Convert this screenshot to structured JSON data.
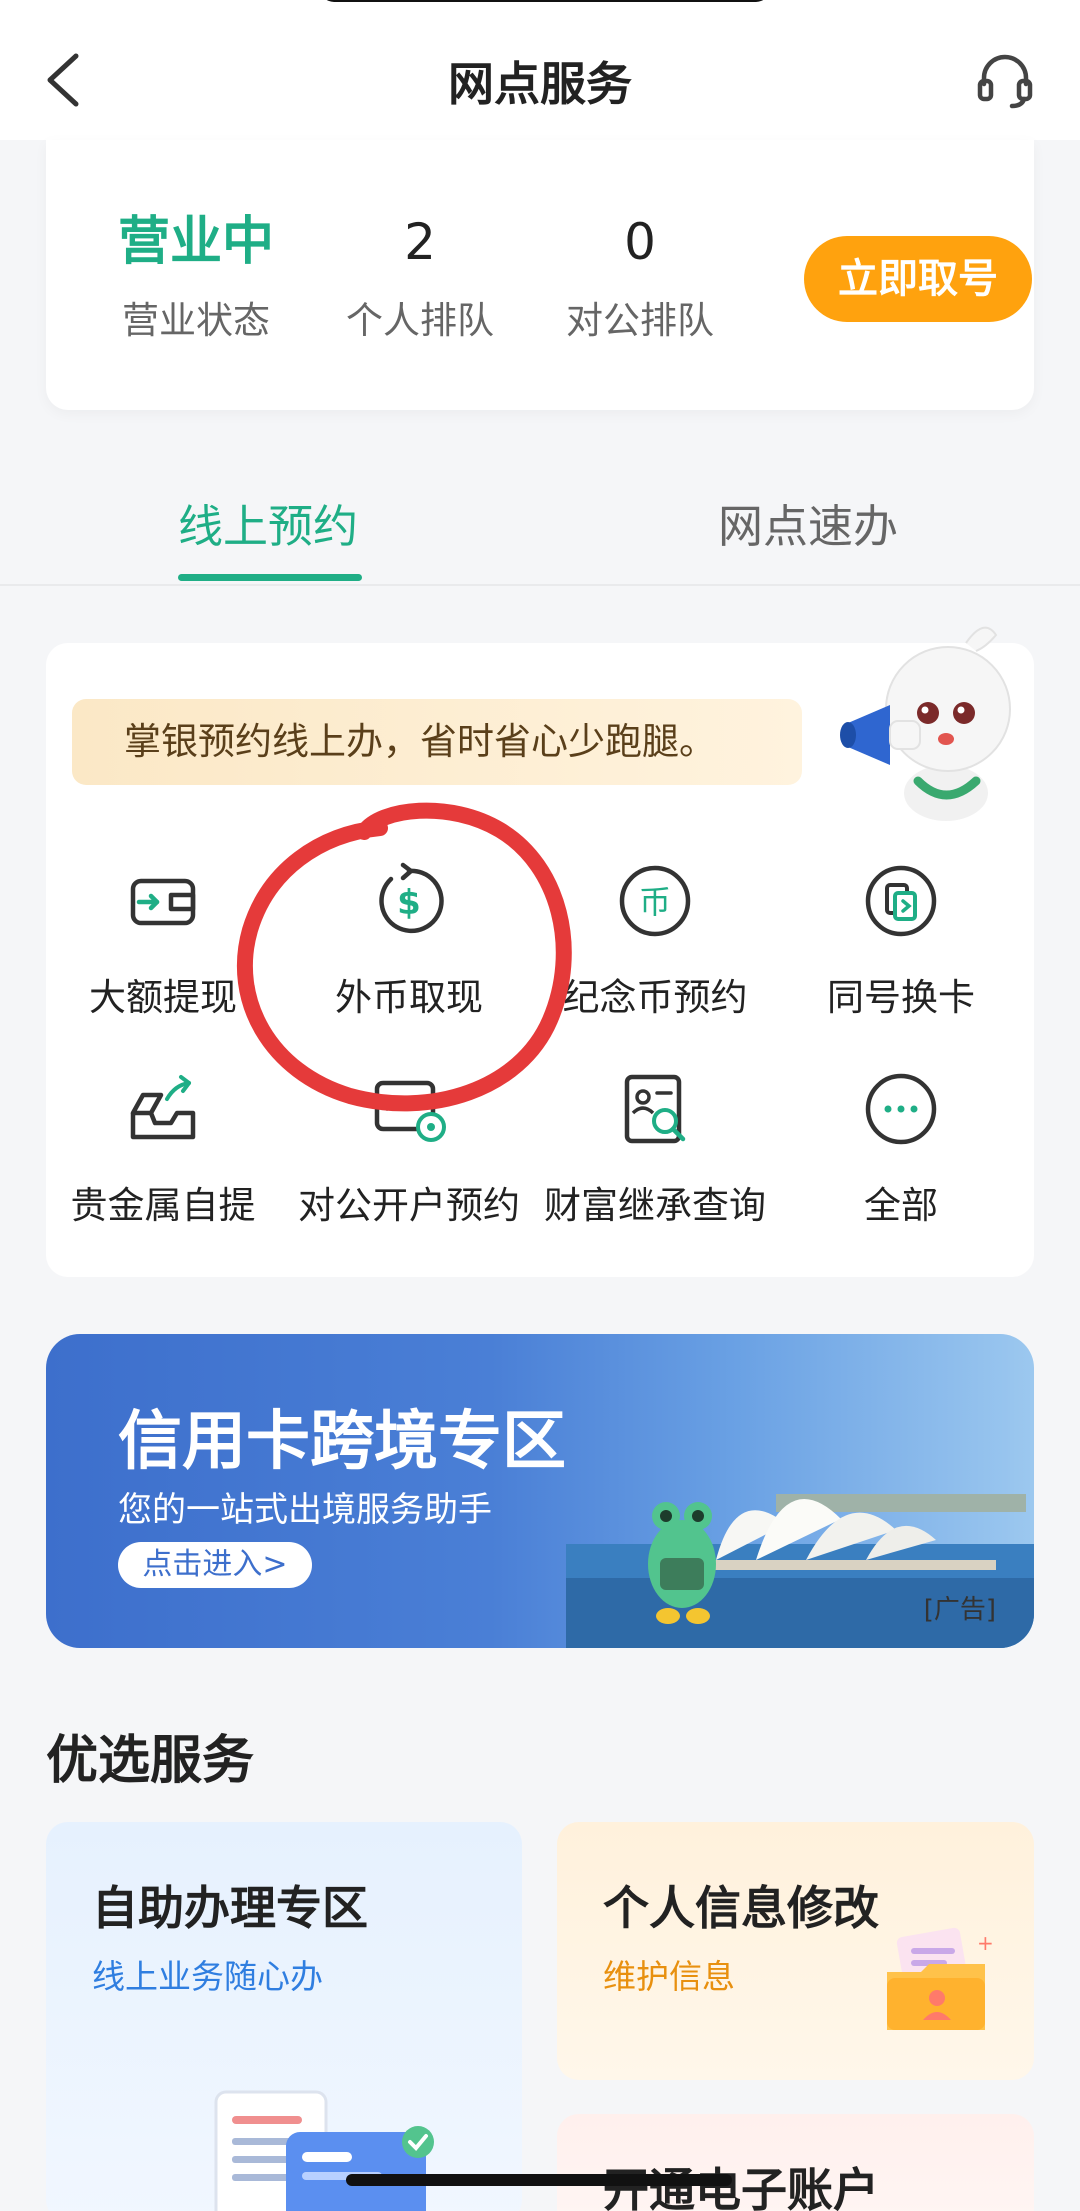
{
  "header": {
    "title": "网点服务"
  },
  "branch_status": {
    "business_status": {
      "value": "营业中",
      "label": "营业状态"
    },
    "personal_queue": {
      "value": "2",
      "label": "个人排队"
    },
    "corporate_queue": {
      "value": "0",
      "label": "对公排队"
    },
    "ticket_button": "立即取号"
  },
  "tabs": [
    {
      "label": "线上预约",
      "active": true
    },
    {
      "label": "网点速办",
      "active": false
    }
  ],
  "promo_text": "掌银预约线上办，省时省心少跑腿。",
  "services": [
    {
      "label": "大额提现",
      "icon": "wallet-transfer-icon"
    },
    {
      "label": "外币取现",
      "icon": "currency-refresh-icon"
    },
    {
      "label": "纪念币预约",
      "icon": "coin-icon"
    },
    {
      "label": "同号换卡",
      "icon": "card-swap-icon"
    },
    {
      "label": "贵金属自提",
      "icon": "gold-box-icon"
    },
    {
      "label": "对公开户预约",
      "icon": "corporate-account-icon"
    },
    {
      "label": "财富继承查询",
      "icon": "inheritance-search-icon"
    },
    {
      "label": "全部",
      "icon": "more-icon"
    }
  ],
  "banner": {
    "title": "信用卡跨境专区",
    "subtitle": "您的一站式出境服务助手",
    "button": "点击进入>",
    "ad_tag": "[广告]"
  },
  "featured": {
    "title": "优选服务",
    "cards": [
      {
        "title": "自助办理专区",
        "subtitle": "线上业务随心办"
      },
      {
        "title": "个人信息修改",
        "subtitle": "维护信息"
      },
      {
        "title": "开通电子账户",
        "subtitle": ""
      }
    ]
  },
  "colors": {
    "accent": "#1fae86",
    "ticket": "#ffa20e",
    "annotation": "#e53a3a"
  }
}
